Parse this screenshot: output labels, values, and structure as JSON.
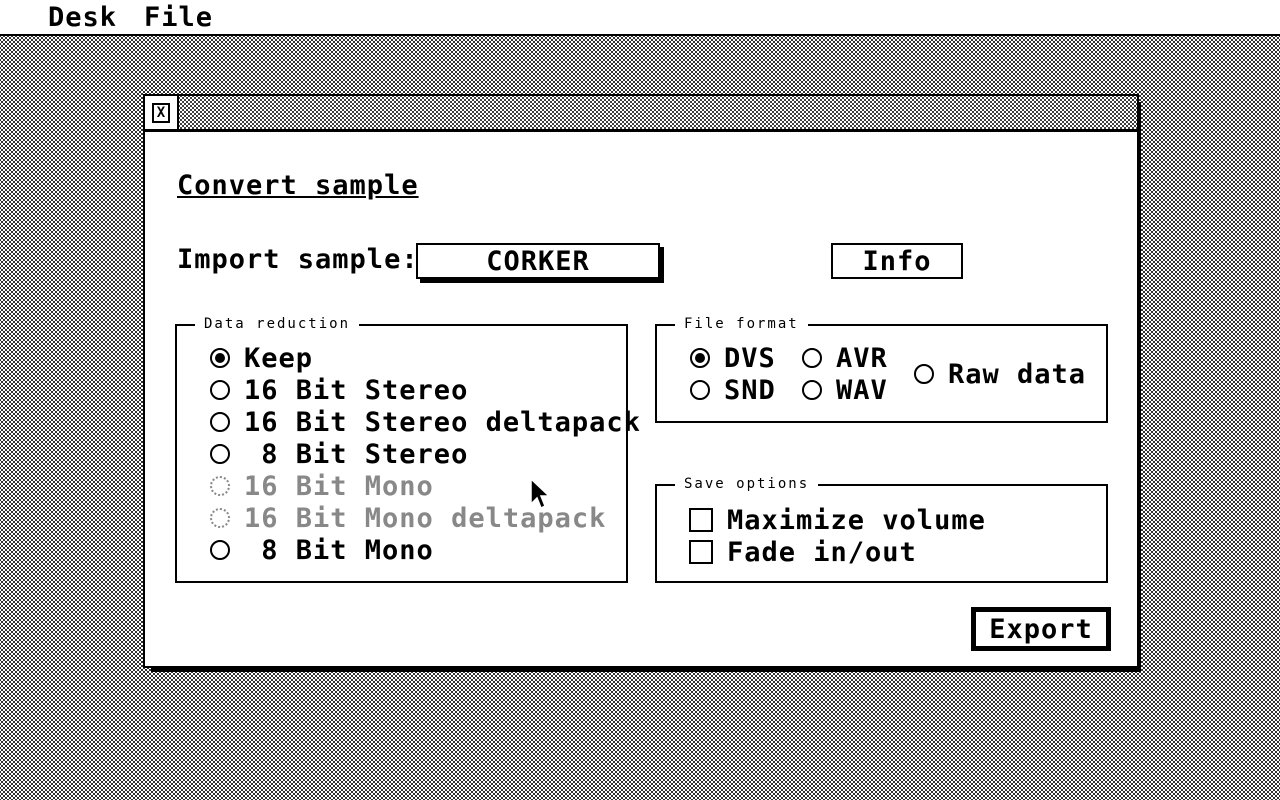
{
  "menubar": {
    "items": [
      "Desk",
      "File"
    ]
  },
  "window": {
    "close_glyph": "X",
    "title": "Convert sample",
    "import": {
      "label": "Import sample:",
      "button_label": "CORKER"
    },
    "info_button_label": "Info",
    "data_reduction": {
      "legend": "Data reduction",
      "options": [
        {
          "label": "Keep",
          "selected": true,
          "enabled": true
        },
        {
          "label": "16 Bit Stereo",
          "selected": false,
          "enabled": true
        },
        {
          "label": "16 Bit Stereo deltapack",
          "selected": false,
          "enabled": true
        },
        {
          "label": " 8 Bit Stereo",
          "selected": false,
          "enabled": true
        },
        {
          "label": "16 Bit Mono",
          "selected": false,
          "enabled": false
        },
        {
          "label": "16 Bit Mono deltapack",
          "selected": false,
          "enabled": false
        },
        {
          "label": " 8 Bit Mono",
          "selected": false,
          "enabled": true
        }
      ]
    },
    "file_format": {
      "legend": "File format",
      "options": [
        {
          "label": "DVS",
          "selected": true
        },
        {
          "label": "SND",
          "selected": false
        },
        {
          "label": "AVR",
          "selected": false
        },
        {
          "label": "WAV",
          "selected": false
        },
        {
          "label": "Raw data",
          "selected": false
        }
      ]
    },
    "save_options": {
      "legend": "Save options",
      "options": [
        {
          "label": "Maximize volume",
          "checked": false
        },
        {
          "label": "Fade in/out",
          "checked": false
        }
      ]
    },
    "export_button_label": "Export"
  }
}
